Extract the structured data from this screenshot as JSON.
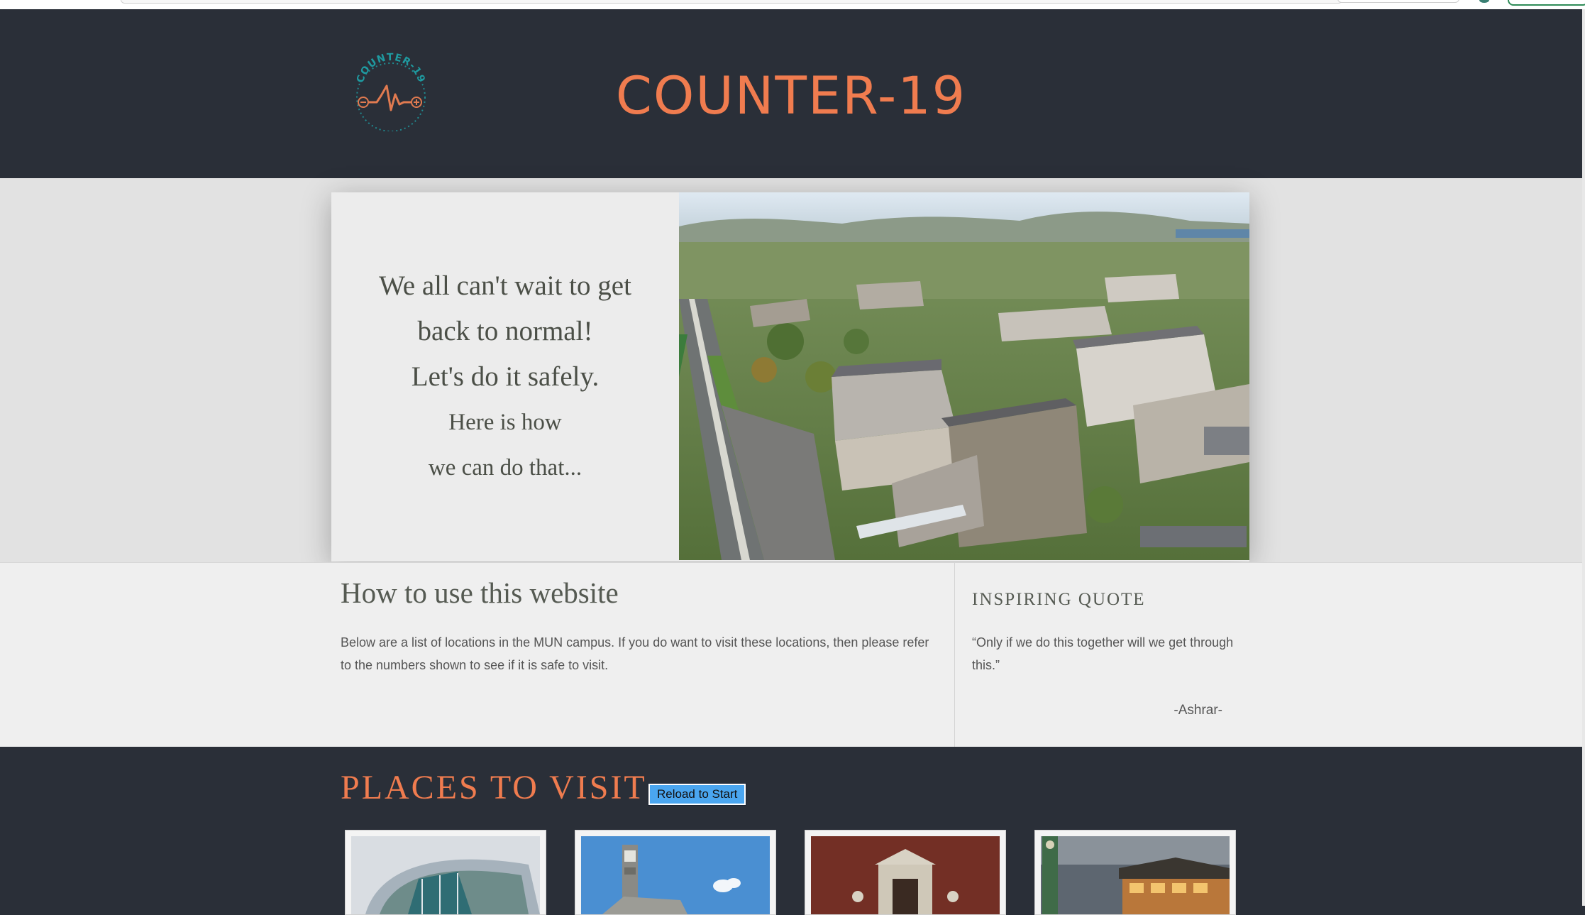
{
  "header": {
    "title": "COUNTER-19",
    "logo_text": "COUNTER-19"
  },
  "hero": {
    "lines": [
      "We all can't wait to get",
      "back to normal!",
      "Let's do it safely.",
      "Here is how",
      "we can do that..."
    ]
  },
  "how_to_use": {
    "title": "How to use this website",
    "text": "Below are a list of locations in the MUN campus. If you do want to visit these locations, then please refer to the numbers shown to see if it is safe to visit."
  },
  "quote": {
    "title": "INSPIRING QUOTE",
    "text": "“Only if we do this together will we get through this.”",
    "author": "-Ashrar-"
  },
  "places": {
    "title": "PLACES TO VISIT",
    "reload_label": "Reload to Start"
  },
  "colors": {
    "accent": "#f07c4f",
    "dark_bg": "#2a2f38",
    "logo_teal": "#1f9aa0"
  }
}
